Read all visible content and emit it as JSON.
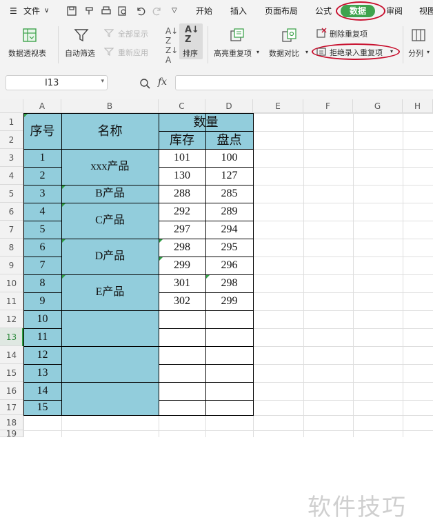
{
  "menu": {
    "file": "文件",
    "tabs": [
      "开始",
      "插入",
      "页面布局",
      "公式",
      "数据",
      "审阅",
      "视图"
    ],
    "active_tab": "数据"
  },
  "ribbon": {
    "pivot": "数据透视表",
    "autofilter": "自动筛选",
    "show_all": "全部显示",
    "reapply": "重新应用",
    "sort": "排序",
    "highlight_dup": "高亮重复项",
    "compare": "数据对比",
    "remove_dup": "删除重复项",
    "reject_dup": "拒绝录入重复项",
    "split": "分列"
  },
  "formula_bar": {
    "name_box": "I13",
    "fx": "fx",
    "formula": ""
  },
  "columns": [
    "A",
    "B",
    "C",
    "D",
    "E",
    "F",
    "G",
    "H"
  ],
  "rows": [
    "1",
    "2",
    "3",
    "4",
    "5",
    "6",
    "7",
    "8",
    "9",
    "10",
    "11",
    "12",
    "13",
    "14",
    "15",
    "16",
    "17",
    "18",
    "19"
  ],
  "selected_row": "13",
  "table": {
    "h_index": "序号",
    "h_name": "名称",
    "h_qty": "数量",
    "h_stock": "库存",
    "h_count": "盘点",
    "seq": [
      "1",
      "2",
      "3",
      "4",
      "5",
      "6",
      "7",
      "8",
      "9",
      "10",
      "11",
      "12",
      "13",
      "14",
      "15"
    ],
    "names": [
      "xxx产品",
      "B产品",
      "C产品",
      "D产品",
      "E产品"
    ],
    "stock": [
      "101",
      "130",
      "288",
      "292",
      "297",
      "298",
      "299",
      "301",
      "302"
    ],
    "count": [
      "100",
      "127",
      "285",
      "289",
      "294",
      "295",
      "296",
      "298",
      "299"
    ]
  },
  "watermark": "软件技巧",
  "colors": {
    "accent_green": "#3fa34d",
    "table_fill": "#92cddc",
    "highlight_oval": "#c8102e"
  }
}
